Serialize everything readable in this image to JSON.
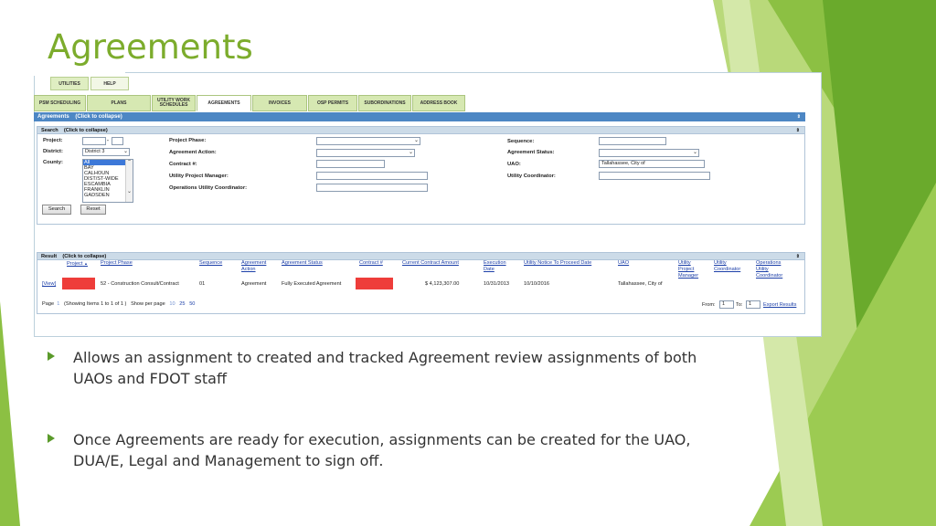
{
  "slide": {
    "title": "Agreements"
  },
  "top_tabs": [
    "UTILITIES",
    "HELP"
  ],
  "module_tabs": [
    {
      "label": "PSM SCHEDULING",
      "active": false
    },
    {
      "label": "PLANS",
      "active": false
    },
    {
      "label": "UTILITY WORK SCHEDULES",
      "active": false
    },
    {
      "label": "AGREEMENTS",
      "active": true
    },
    {
      "label": "INVOICES",
      "active": false
    },
    {
      "label": "OSP PERMITS",
      "active": false
    },
    {
      "label": "SUBORDINATIONS",
      "active": false
    },
    {
      "label": "ADDRESS BOOK",
      "active": false
    }
  ],
  "agreements_bar": {
    "title": "Agreements",
    "collapse": "(Click to collapse)"
  },
  "search": {
    "title": "Search",
    "collapse": "(Click to collapse)",
    "project_label": "Project:",
    "project_sep": "-",
    "district_label": "District:",
    "district_value": "District 3",
    "county_label": "County:",
    "county_options": [
      "All",
      "BAY",
      "CALHOUN",
      "DIST/ST-WIDE",
      "ESCAMBIA",
      "FRANKLIN",
      "GADSDEN"
    ],
    "project_phase_label": "Project Phase:",
    "agreement_action_label": "Agreement Action:",
    "contract_label": "Contract #:",
    "upm_label": "Utility Project Manager:",
    "ouc_label": "Operations Utility Coordinator:",
    "sequence_label": "Sequence:",
    "agreement_status_label": "Agreement Status:",
    "uao_label": "UAO:",
    "uao_value": "Tallahassee, City of",
    "uc_label": "Utility Coordinator:",
    "search_button": "Search",
    "reset_button": "Reset"
  },
  "result": {
    "title": "Result",
    "collapse": "(Click to collapse)",
    "headers": {
      "project": "Project",
      "sort_arrow": "▲",
      "project_phase": "Project Phase",
      "sequence": "Sequence",
      "agreement_action_1": "Agreement",
      "agreement_action_2": "Action",
      "agreement_status": "Agreement Status",
      "contract": "Contract #",
      "current_amount": "Current Contract Amount",
      "execution_1": "Execution",
      "execution_2": "Date",
      "utility_notice": "Utility Notice To Proceed Date",
      "uao": "UAO",
      "upm_1": "Utility",
      "upm_2": "Project",
      "upm_3": "Manager",
      "uc_1": "Utility",
      "uc_2": "Coordinator",
      "ouc_1": "Operations",
      "ouc_2": "Utility",
      "ouc_3": "Coordinator"
    },
    "row": {
      "view": "[View]",
      "project_phase": "52 - Construction Consult/Contract",
      "sequence": "01",
      "agreement_action": "Agreement",
      "agreement_status": "Fully Executed Agreement",
      "amount": "$ 4,123,307.00",
      "execution_date": "10/31/2013",
      "notice_date": "10/10/2016",
      "uao": "Tallahassee, City of"
    },
    "pager": {
      "page_label": "Page",
      "page_num": "1",
      "showing": "(Showing Items 1 to 1 of 1 )",
      "show_per_page": "Show per page",
      "sizes": [
        "10",
        "25",
        "50"
      ],
      "from_label": "From:",
      "from_value": "1",
      "to_label": "To:",
      "to_value": "1",
      "export": "Export Results"
    }
  },
  "bullets": [
    "Allows an assignment to created and tracked Agreement review assignments of both UAOs and FDOT staff",
    "Once Agreements are ready for execution, assignments can be created for the UAO, DUA/E, Legal and Management to sign off."
  ],
  "colors": {
    "accent_green": "#7cac2c",
    "bar_blue": "#4d87c4",
    "redaction": "#ee3d3a"
  }
}
